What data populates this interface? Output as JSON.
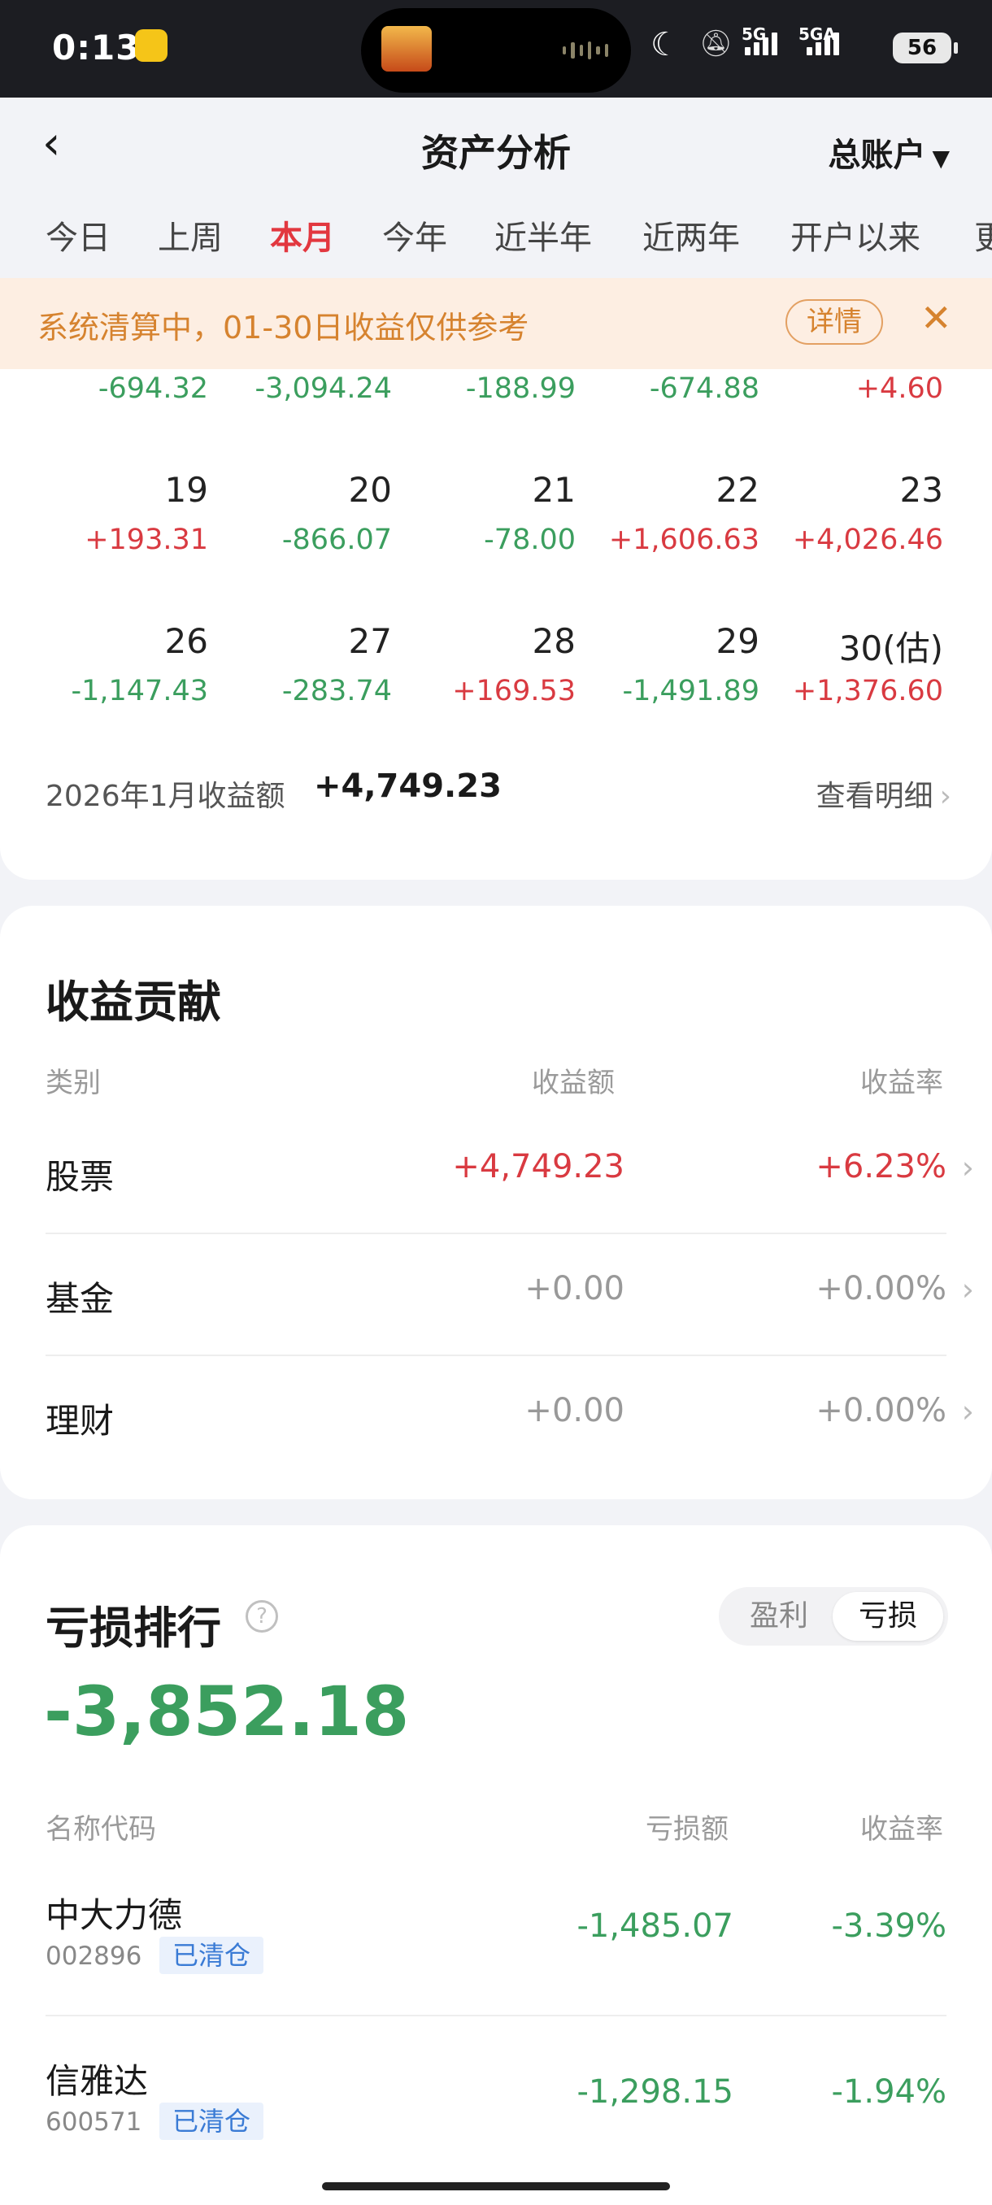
{
  "status_bar": {
    "time": "0:13",
    "network1": "5G",
    "network2": "5GA",
    "battery": "56"
  },
  "header": {
    "back_icon": "chevron-left-icon",
    "title": "资产分析",
    "account": "总账户"
  },
  "tabs": [
    "今日",
    "上周",
    "本月",
    "今年",
    "近半年",
    "近两年",
    "开户以来",
    "更"
  ],
  "active_tab": "本月",
  "notice": {
    "text": "系统清算中，01-30日收益仅供参考",
    "detail_label": "详情"
  },
  "calendar": {
    "partial_row_values": [
      "-694.32",
      "-3,094.24",
      "-188.99",
      "-674.88",
      "+4.60"
    ],
    "rows": [
      {
        "days": [
          "19",
          "20",
          "21",
          "22",
          "23"
        ],
        "values": [
          "+193.31",
          "-866.07",
          "-78.00",
          "+1,606.63",
          "+4,026.46"
        ]
      },
      {
        "days": [
          "26",
          "27",
          "28",
          "29",
          "30(估)"
        ],
        "values": [
          "-1,147.43",
          "-283.74",
          "+169.53",
          "-1,491.89",
          "+1,376.60"
        ]
      }
    ],
    "month_label": "2026年1月收益额",
    "month_total": "+4,749.23",
    "detail_link": "查看明细"
  },
  "contribution": {
    "title": "收益贡献",
    "headers": {
      "category": "类别",
      "amount": "收益额",
      "rate": "收益率"
    },
    "rows": [
      {
        "name": "股票",
        "amount": "+4,749.23",
        "rate": "+6.23%"
      },
      {
        "name": "基金",
        "amount": "+0.00",
        "rate": "+0.00%"
      },
      {
        "name": "理财",
        "amount": "+0.00",
        "rate": "+0.00%"
      }
    ]
  },
  "loss_ranking": {
    "title": "亏损排行",
    "toggle": {
      "profit": "盈利",
      "loss": "亏损"
    },
    "total": "-3,852.18",
    "headers": {
      "name": "名称代码",
      "amount": "亏损额",
      "rate": "收益率"
    },
    "rows": [
      {
        "name": "中大力德",
        "code": "002896",
        "badge": "已清仓",
        "amount": "-1,485.07",
        "rate": "-3.39%"
      },
      {
        "name": "信雅达",
        "code": "600571",
        "badge": "已清仓",
        "amount": "-1,298.15",
        "rate": "-1.94%"
      }
    ]
  },
  "colors": {
    "gain": "#d93a41",
    "loss": "#3b9e5e",
    "accent": "#e2373f",
    "notice": "#d6832f"
  }
}
